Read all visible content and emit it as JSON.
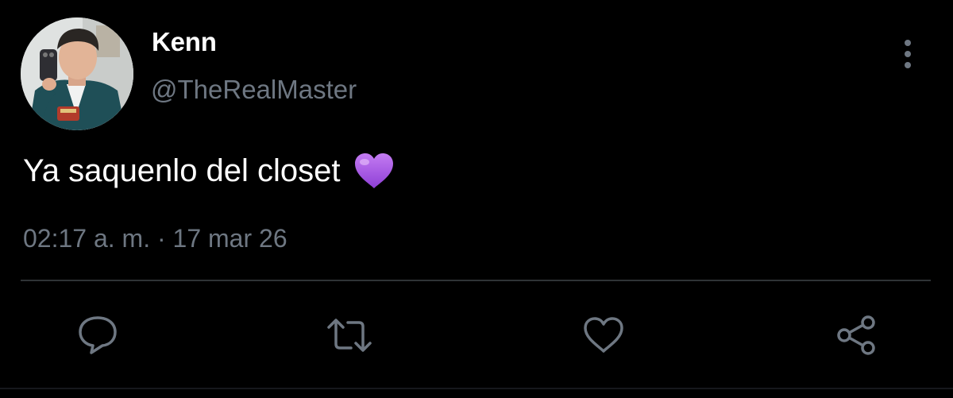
{
  "tweet": {
    "author": {
      "display_name": "Kenn",
      "handle": "@TheRealMaster",
      "avatar": "avatar-photo"
    },
    "text": "Ya saquenlo del closet",
    "emoji": "💜",
    "timestamp": "02:17 a. m. · 17 mar 26"
  },
  "actions": [
    {
      "name": "reply",
      "icon": "speech-bubble-icon"
    },
    {
      "name": "retweet",
      "icon": "retweet-icon"
    },
    {
      "name": "like",
      "icon": "heart-outline-icon"
    },
    {
      "name": "share",
      "icon": "share-icon"
    }
  ],
  "colors": {
    "background": "#000000",
    "primary_text": "#ffffff",
    "secondary_text": "#6e7782",
    "icon": "#6e7782",
    "divider": "#2f3336",
    "emoji_purple": "#a855f7"
  }
}
